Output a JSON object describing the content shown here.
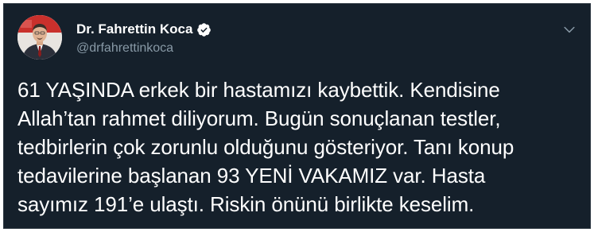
{
  "tweet": {
    "author": {
      "name": "Dr. Fahrettin Koca",
      "handle": "@drfahrettinkoca",
      "verified": true
    },
    "text": "61 YAŞINDA erkek bir hastamızı kaybettik. Kendisine\nAllah’tan rahmet diliyorum. Bugün sonuçlanan testler,\ntedbirlerin çok zorunlu olduğunu gösteriyor. Tanı konup\ntedavilerine başlanan 93 YENİ VAKAMIZ var. Hasta\nsayımız 191’e ulaştı. Riskin önünü birlikte keselim."
  },
  "theme": {
    "background": "#15202b",
    "text": "#ffffff",
    "secondary_text": "#8899a6",
    "verified_badge": "#ffffff"
  },
  "icons": {
    "verified": "verified-badge-icon",
    "caret": "chevron-down-icon"
  }
}
